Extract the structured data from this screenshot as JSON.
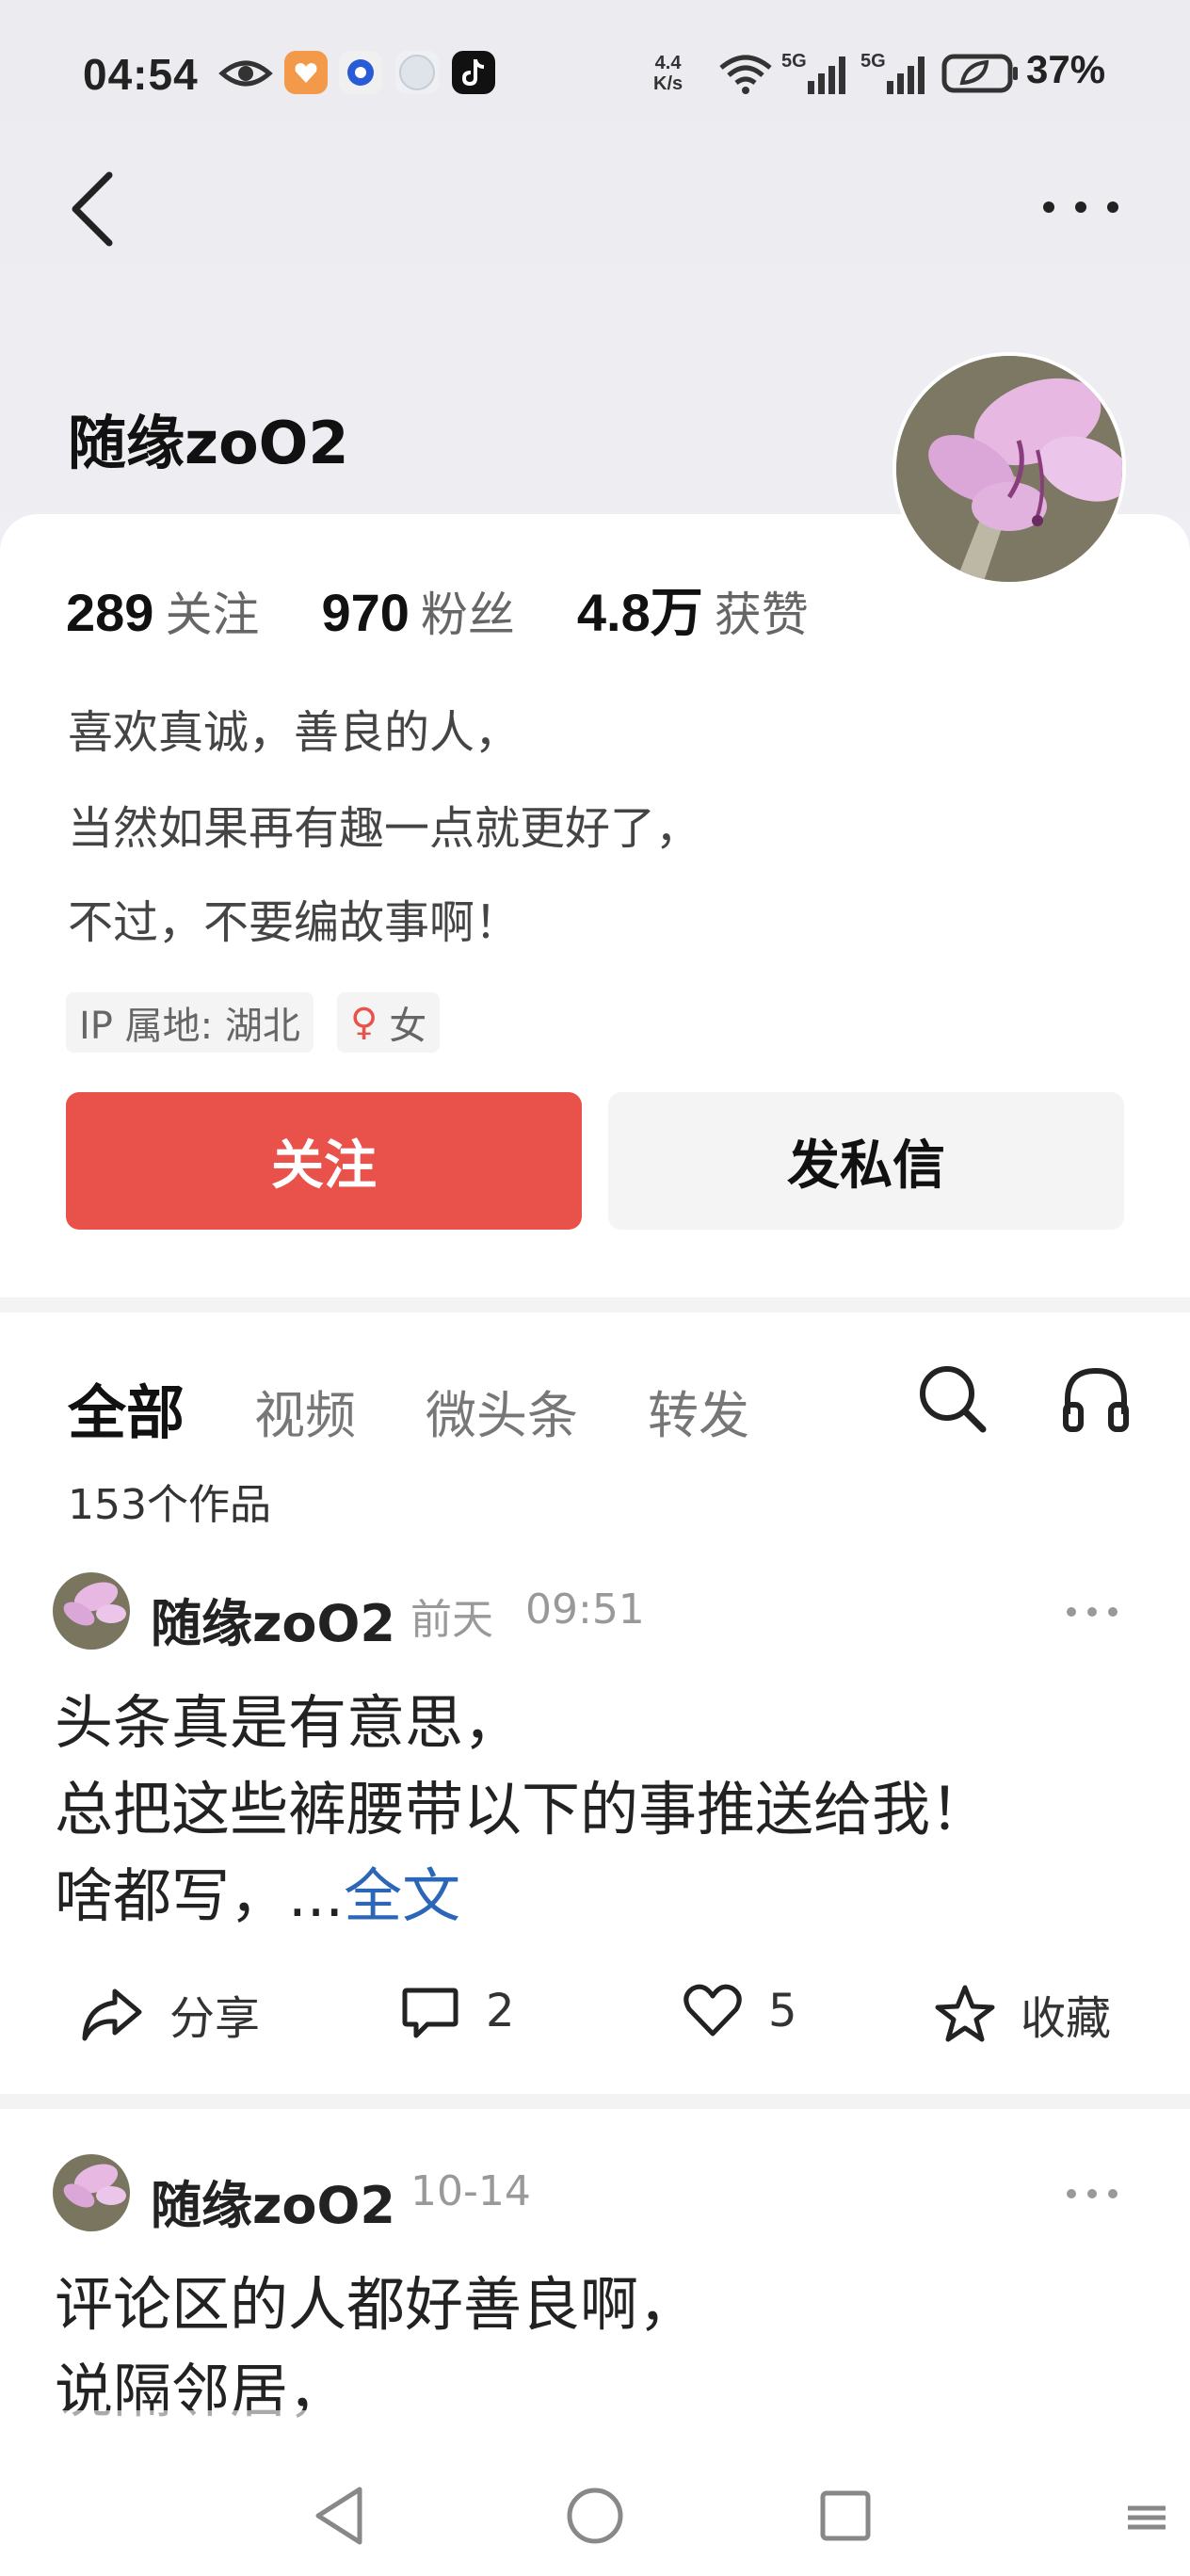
{
  "status_bar": {
    "time": "04:54",
    "speed_value": "4.4",
    "speed_unit": "K/s",
    "battery": "37%",
    "signal1": "5G",
    "signal2": "5G"
  },
  "profile": {
    "name": "随缘zoO2",
    "following_count": "289",
    "following_label": "关注",
    "followers_count": "970",
    "followers_label": "粉丝",
    "likes_count": "4.8万",
    "likes_label": "获赞",
    "bio_lines": [
      "喜欢真诚，善良的人，",
      "当然如果再有趣一点就更好了，",
      "不过，不要编故事啊！"
    ],
    "ip_tag": "IP 属地: 湖北",
    "gender_symbol": "♀",
    "gender_label": "女",
    "follow_button": "关注",
    "message_button": "发私信"
  },
  "tabs": [
    {
      "label": "全部",
      "active": true
    },
    {
      "label": "视频",
      "active": false
    },
    {
      "label": "微头条",
      "active": false
    },
    {
      "label": "转发",
      "active": false
    }
  ],
  "works_count": "153个作品",
  "posts": [
    {
      "author": "随缘zoO2",
      "date": "前天",
      "time": "09:51",
      "lines": [
        "头条真是有意思，",
        "总把这些裤腰带以下的事推送给我！"
      ],
      "last_line": "啥都写，...",
      "more_link": "全文",
      "share_label": "分享",
      "comments": "2",
      "likes": "5",
      "favorite_label": "收藏"
    },
    {
      "author": "随缘zoO2",
      "date": "10-14",
      "lines": [
        "评论区的人都好善良啊，",
        "说隔邻居，"
      ]
    }
  ],
  "colors": {
    "accent": "#e9524a",
    "link": "#2b66b9"
  }
}
